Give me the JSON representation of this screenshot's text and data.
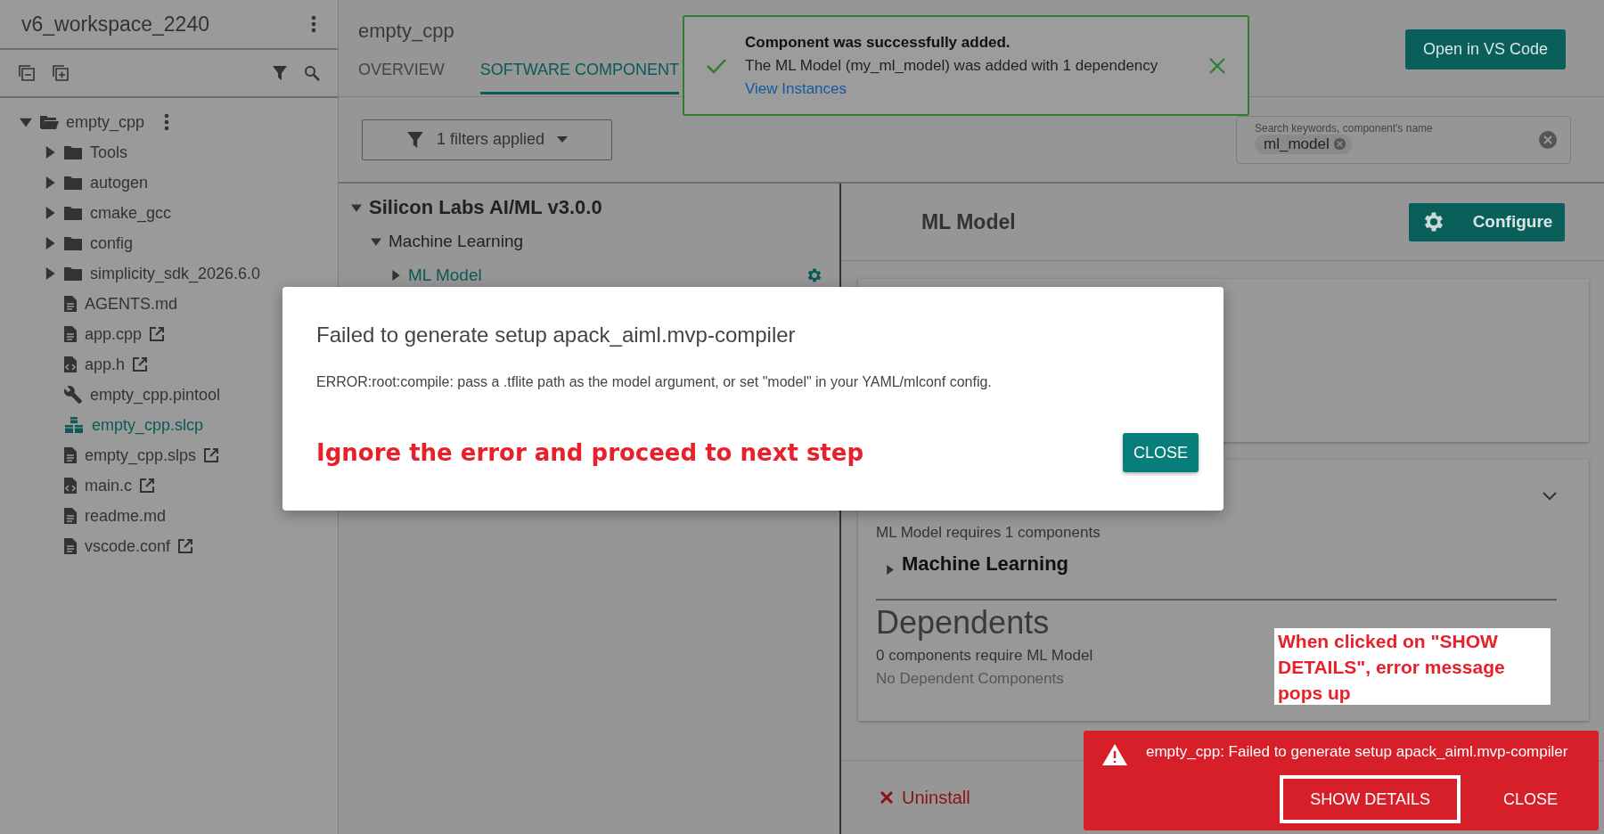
{
  "sidebar": {
    "title": "v6_workspace_2240",
    "tree": [
      {
        "label": "empty_cpp",
        "kind": "folder",
        "expanded": true,
        "selected": false,
        "external": false,
        "children": [
          {
            "label": "Tools",
            "kind": "folder",
            "expanded": false,
            "selected": false,
            "external": false
          },
          {
            "label": "autogen",
            "kind": "folder",
            "expanded": false,
            "selected": false,
            "external": false
          },
          {
            "label": "cmake_gcc",
            "kind": "folder",
            "expanded": false,
            "selected": false,
            "external": false
          },
          {
            "label": "config",
            "kind": "folder",
            "expanded": false,
            "selected": false,
            "external": false
          },
          {
            "label": "simplicity_sdk_2026.6.0",
            "kind": "folder",
            "expanded": false,
            "selected": false,
            "external": false
          },
          {
            "label": "AGENTS.md",
            "kind": "file",
            "selected": false,
            "external": false
          },
          {
            "label": "app.cpp",
            "kind": "file",
            "selected": false,
            "external": true
          },
          {
            "label": "app.h",
            "kind": "code",
            "selected": false,
            "external": true
          },
          {
            "label": "empty_cpp.pintool",
            "kind": "tool",
            "selected": false,
            "external": false
          },
          {
            "label": "empty_cpp.slcp",
            "kind": "project",
            "selected": true,
            "external": false
          },
          {
            "label": "empty_cpp.slps",
            "kind": "file",
            "selected": false,
            "external": true
          },
          {
            "label": "main.c",
            "kind": "code",
            "selected": false,
            "external": true
          },
          {
            "label": "readme.md",
            "kind": "file",
            "selected": false,
            "external": false
          },
          {
            "label": "vscode.conf",
            "kind": "file",
            "selected": false,
            "external": true
          }
        ]
      }
    ]
  },
  "header": {
    "title": "empty_cpp",
    "tabs": [
      {
        "label": "OVERVIEW",
        "selected": false
      },
      {
        "label": "SOFTWARE COMPONENT",
        "selected": true
      }
    ],
    "open_button": "Open in VS Code"
  },
  "toast": {
    "title": "Component was successfully added.",
    "message": "The ML Model (my_ml_model) was added with 1 dependency",
    "link": "View Instances"
  },
  "filter": {
    "label": "1 filters applied"
  },
  "search": {
    "label": "Search keywords, component's name",
    "chips": [
      "ml_model"
    ]
  },
  "component_tree": [
    {
      "label": "Silicon Labs AI/ML v3.0.0",
      "expanded": true,
      "selected": false,
      "children": [
        {
          "label": "Machine Learning",
          "expanded": true,
          "selected": false,
          "children": [
            {
              "label": "ML Model",
              "expanded": false,
              "selected": true,
              "configurable": true
            }
          ]
        }
      ]
    }
  ],
  "details": {
    "title": "ML Model",
    "configure_button": "Configure",
    "requires": "ML Model requires 1 components",
    "dependencies": [
      {
        "label": "Machine Learning",
        "expanded": false
      }
    ],
    "dependents_heading": "Dependents",
    "dependents_count": "0 components require ML Model",
    "dependents_empty": "No Dependent Components",
    "uninstall": "Uninstall"
  },
  "modal": {
    "title": "Failed to generate setup apack_aiml.mvp-compiler",
    "message": "ERROR:root:compile: pass a .tflite path as the model argument, or set \"model\" in your YAML/mlconf config.",
    "note": "Ignore the error and proceed to next step",
    "button": "CLOSE"
  },
  "callout": "When clicked on \"SHOW DETAILS\", error message pops up",
  "snackbar": {
    "message": "empty_cpp: Failed to generate setup apack_aiml.mvp-compiler",
    "actions": [
      {
        "label": "SHOW DETAILS",
        "highlighted": true
      },
      {
        "label": "CLOSE",
        "highlighted": false
      }
    ]
  }
}
